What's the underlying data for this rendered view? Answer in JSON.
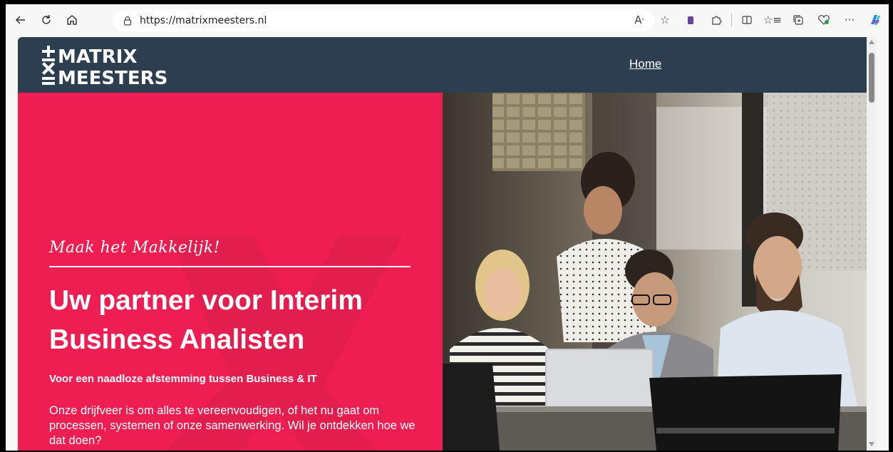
{
  "browser": {
    "url": "https://matrixmeesters.nl",
    "more_label": "···"
  },
  "site": {
    "logo": {
      "line1": "MATRIX",
      "line2": "MEESTERS"
    },
    "nav": {
      "home": "Home"
    },
    "hero": {
      "tagline": "Maak het Makkelijk!",
      "headline_line1": "Uw partner voor Interim",
      "headline_line2": "Business Analisten",
      "subhead": "Voor een naadloze afstemming tussen Business & IT",
      "body": "Onze drijfveer is om alles te vereenvoudigen, of het nu gaat om processen, systemen of onze samenwerking. Wil je ontdekken hoe we dat doen?"
    }
  },
  "colors": {
    "header_bg": "#2d3e50",
    "hero_bg": "#ee1d52"
  }
}
